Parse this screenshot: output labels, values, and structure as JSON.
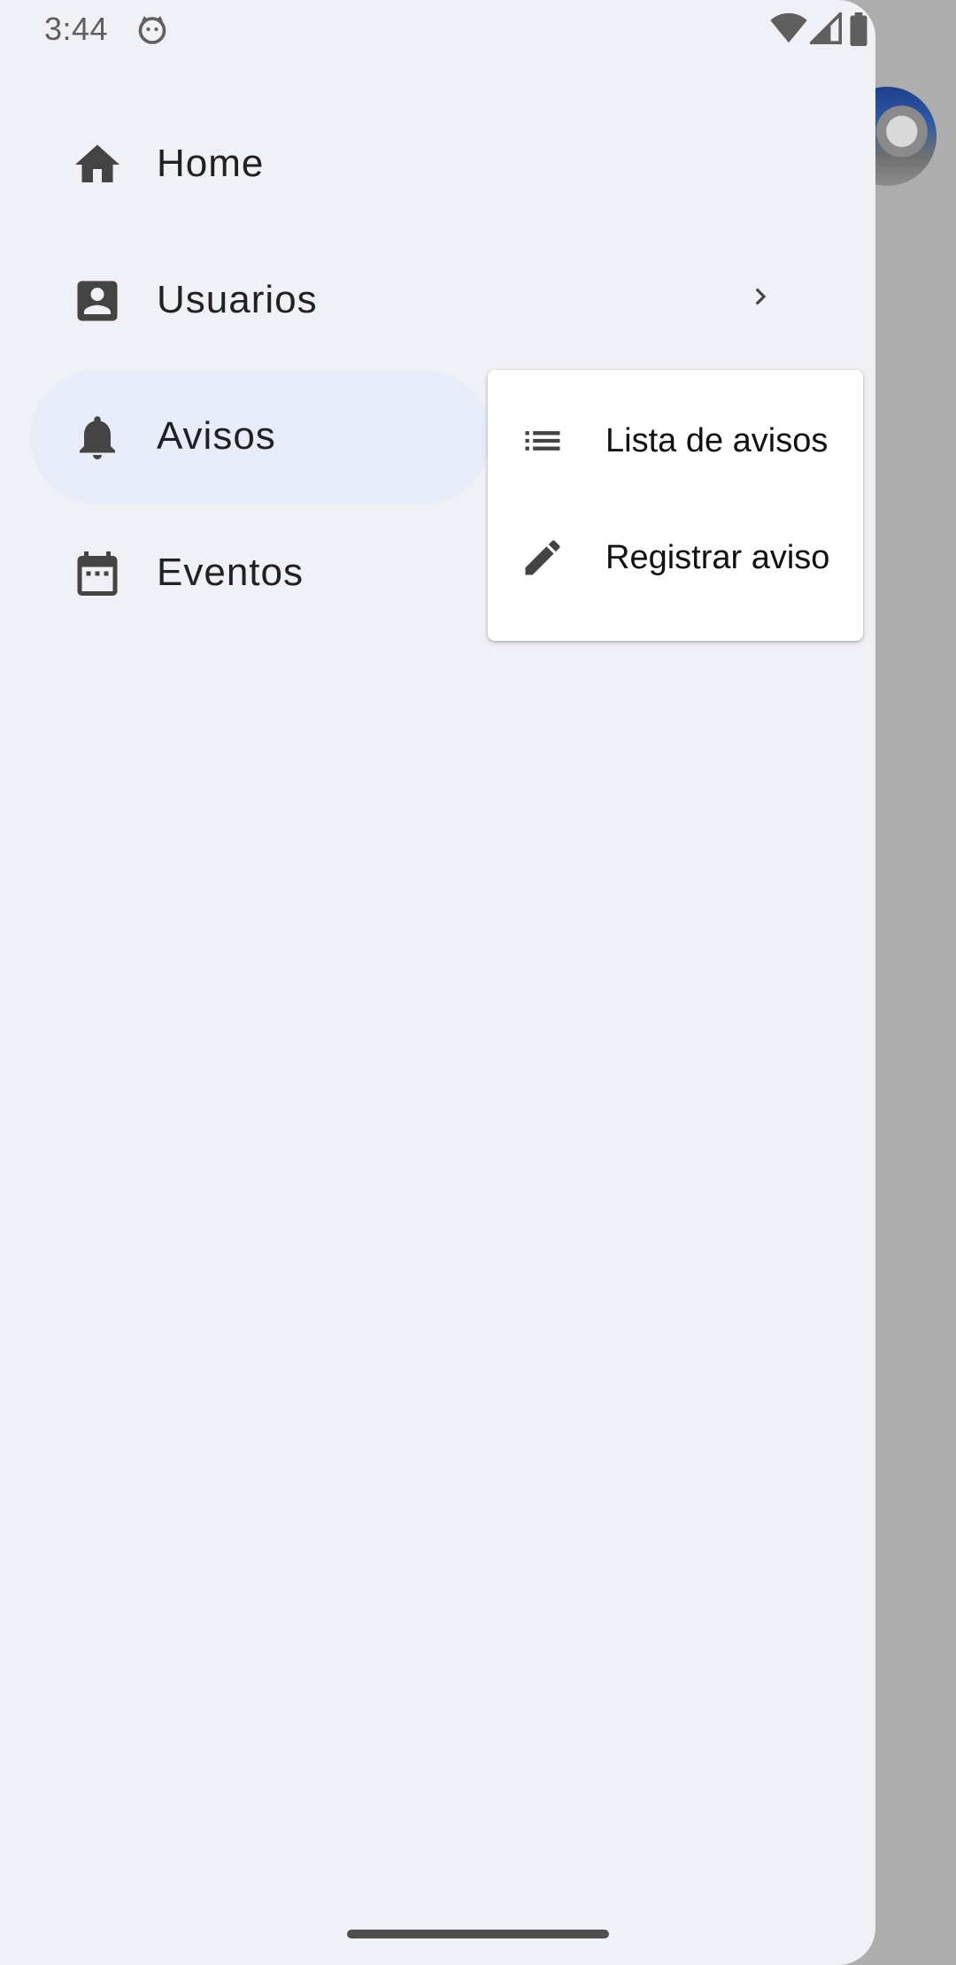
{
  "status_bar": {
    "time": "3:44",
    "app_icon": "cat-face-icon",
    "wifi_icon": "wifi-icon",
    "signal_icon": "cell-signal-icon",
    "battery_icon": "battery-icon"
  },
  "drawer": {
    "items": [
      {
        "label": "Home",
        "icon": "home-icon"
      },
      {
        "label": "Usuarios",
        "icon": "account-box-icon",
        "has_submenu": true
      },
      {
        "label": "Avisos",
        "icon": "bell-icon",
        "active": true
      },
      {
        "label": "Eventos",
        "icon": "calendar-icon"
      }
    ],
    "active_color": "#e8ecf9",
    "background_color": "#f0f0f7"
  },
  "submenu": {
    "items": [
      {
        "label": "Lista de avisos",
        "icon": "list-icon"
      },
      {
        "label": "Registrar aviso",
        "icon": "pencil-icon"
      }
    ]
  },
  "profile": {
    "avatar_icon": "avatar"
  }
}
